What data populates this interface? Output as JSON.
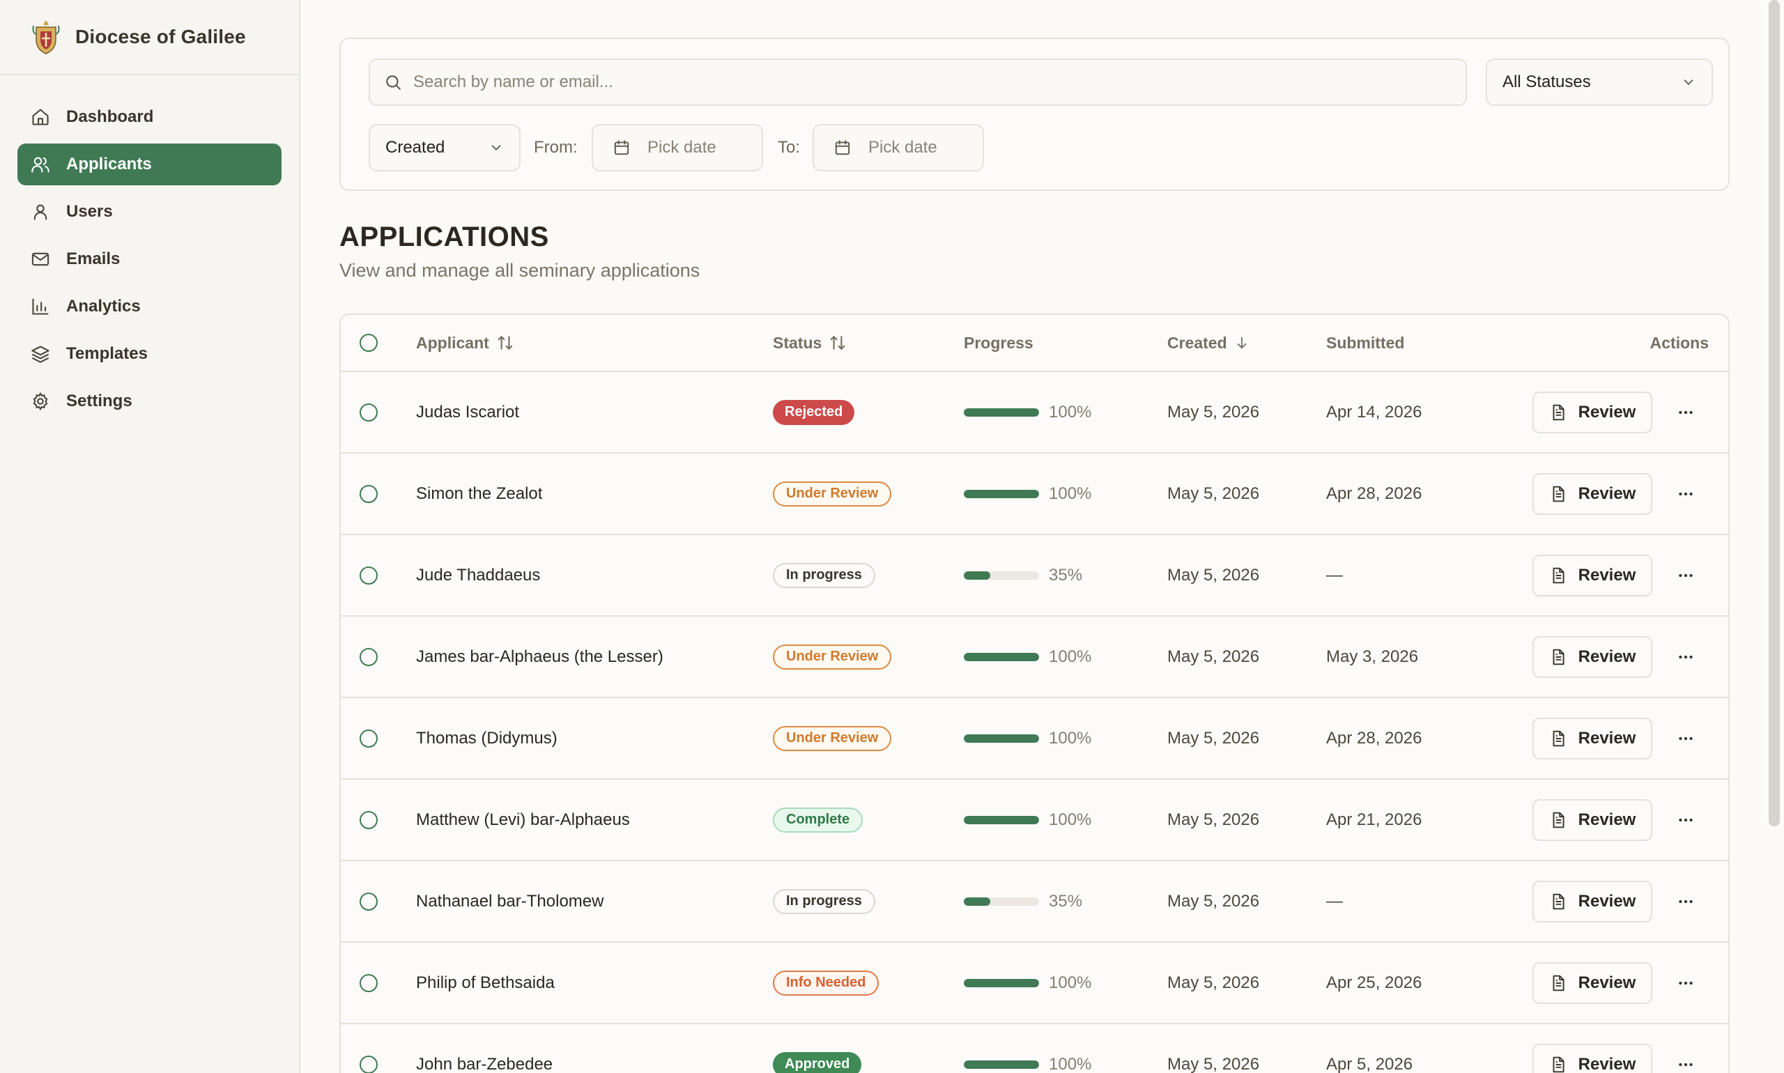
{
  "brand": {
    "name": "Diocese of Galilee"
  },
  "sidebar": {
    "items": [
      {
        "label": "Dashboard",
        "icon": "home-icon"
      },
      {
        "label": "Applicants",
        "icon": "users-icon",
        "active": true
      },
      {
        "label": "Users",
        "icon": "user-icon"
      },
      {
        "label": "Emails",
        "icon": "mail-icon"
      },
      {
        "label": "Analytics",
        "icon": "bar-chart-icon"
      },
      {
        "label": "Templates",
        "icon": "layers-icon"
      },
      {
        "label": "Settings",
        "icon": "gear-icon"
      }
    ]
  },
  "filters": {
    "search_placeholder": "Search by name or email...",
    "status_select": "All Statuses",
    "date_field_select": "Created",
    "from_label": "From:",
    "to_label": "To:",
    "from_placeholder": "Pick date",
    "to_placeholder": "Pick date"
  },
  "page": {
    "title": "APPLICATIONS",
    "subtitle": "View and manage all seminary applications"
  },
  "table": {
    "headers": {
      "applicant": "Applicant",
      "status": "Status",
      "progress": "Progress",
      "created": "Created",
      "submitted": "Submitted",
      "actions": "Actions"
    },
    "review_label": "Review",
    "rows": [
      {
        "name": "Judas Iscariot",
        "status": "Rejected",
        "status_kind": "rejected",
        "progress": 100,
        "progress_text": "100%",
        "created": "May 5, 2026",
        "submitted": "Apr 14, 2026"
      },
      {
        "name": "Simon the Zealot",
        "status": "Under Review",
        "status_kind": "review",
        "progress": 100,
        "progress_text": "100%",
        "created": "May 5, 2026",
        "submitted": "Apr 28, 2026"
      },
      {
        "name": "Jude Thaddaeus",
        "status": "In progress",
        "status_kind": "progress",
        "progress": 35,
        "progress_text": "35%",
        "created": "May 5, 2026",
        "submitted": "—"
      },
      {
        "name": "James bar-Alphaeus (the Lesser)",
        "status": "Under Review",
        "status_kind": "review",
        "progress": 100,
        "progress_text": "100%",
        "created": "May 5, 2026",
        "submitted": "May 3, 2026"
      },
      {
        "name": "Thomas (Didymus)",
        "status": "Under Review",
        "status_kind": "review",
        "progress": 100,
        "progress_text": "100%",
        "created": "May 5, 2026",
        "submitted": "Apr 28, 2026"
      },
      {
        "name": "Matthew (Levi) bar-Alphaeus",
        "status": "Complete",
        "status_kind": "complete",
        "progress": 100,
        "progress_text": "100%",
        "created": "May 5, 2026",
        "submitted": "Apr 21, 2026"
      },
      {
        "name": "Nathanael bar-Tholomew",
        "status": "In progress",
        "status_kind": "progress",
        "progress": 35,
        "progress_text": "35%",
        "created": "May 5, 2026",
        "submitted": "—"
      },
      {
        "name": "Philip of Bethsaida",
        "status": "Info Needed",
        "status_kind": "info",
        "progress": 100,
        "progress_text": "100%",
        "created": "May 5, 2026",
        "submitted": "Apr 25, 2026"
      },
      {
        "name": "John bar-Zebedee",
        "status": "Approved",
        "status_kind": "approved",
        "progress": 100,
        "progress_text": "100%",
        "created": "May 5, 2026",
        "submitted": "Apr 5, 2026"
      }
    ]
  },
  "colors": {
    "accent": "#3f7a55",
    "rejected": "#cd4a4a",
    "review": "#dd8a3f",
    "approved": "#3f8a55"
  }
}
